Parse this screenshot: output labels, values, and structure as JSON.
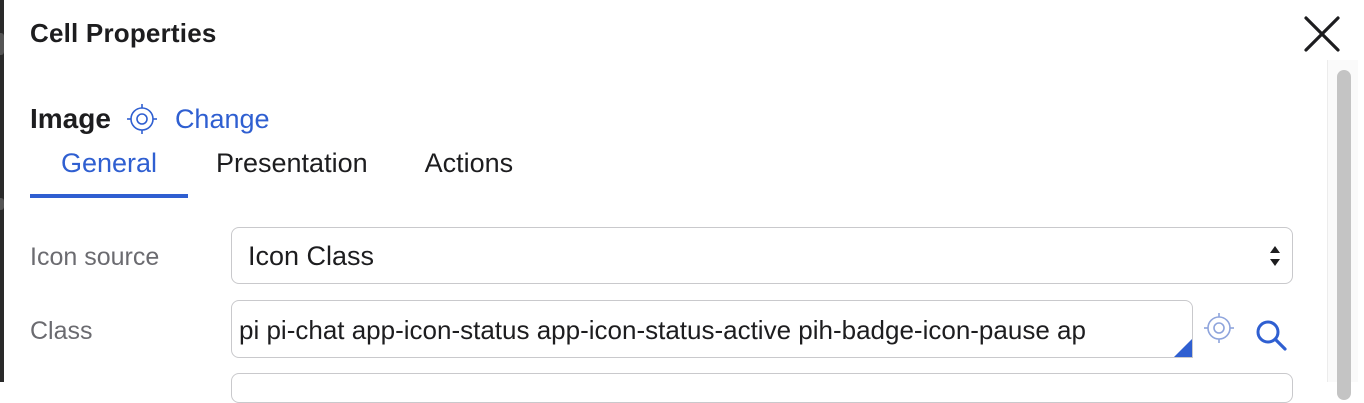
{
  "dialog": {
    "title": "Cell Properties"
  },
  "section": {
    "name": "Image",
    "change_label": "Change"
  },
  "tabs": [
    {
      "label": "General",
      "active": true
    },
    {
      "label": "Presentation",
      "active": false
    },
    {
      "label": "Actions",
      "active": false
    }
  ],
  "fields": {
    "icon_source": {
      "label": "Icon source",
      "value": "Icon Class"
    },
    "class": {
      "label": "Class",
      "value": "pi pi-chat app-icon-status app-icon-status-active pih-badge-icon-pause ap"
    }
  },
  "icons": {
    "close": "close-icon",
    "target": "crosshair-target-icon",
    "search": "search-icon",
    "select_arrows": "select-arrows-icon"
  },
  "colors": {
    "accent": "#2f5fd1",
    "label": "#6b6b70",
    "border": "#c9c9cc"
  }
}
